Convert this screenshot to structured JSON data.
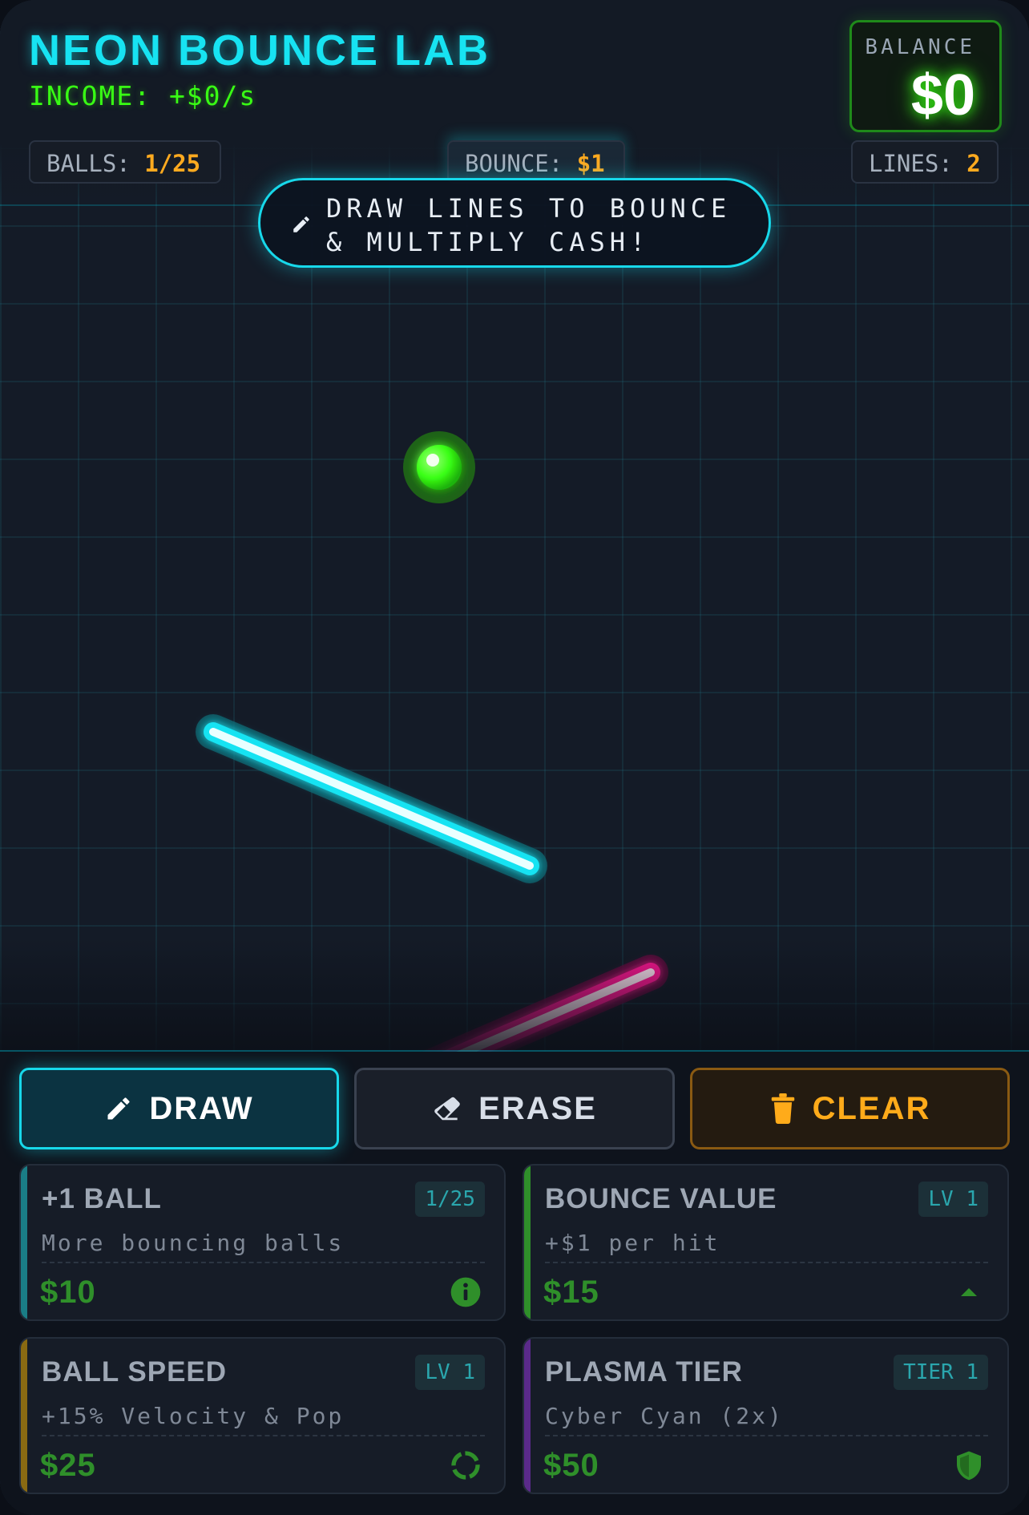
{
  "header": {
    "title": "NEON BOUNCE LAB",
    "income": "INCOME: +$0/s",
    "balance_label": "BALANCE",
    "balance_value": "$0"
  },
  "stats": {
    "balls_label": "BALLS:",
    "balls_value": "1/25",
    "bounce_label": "BOUNCE:",
    "bounce_value": "$1",
    "lines_label": "LINES:",
    "lines_value": "2"
  },
  "hint": {
    "text": "DRAW LINES TO BOUNCE & MULTIPLY CASH!",
    "icon": "pencil-icon"
  },
  "scene": {
    "lines": [
      {
        "color": "#17e3f2",
        "name": "cyan-line"
      },
      {
        "color": "#ff1493",
        "name": "magenta-line"
      }
    ],
    "ball_color": "#39ff14"
  },
  "tools": {
    "draw_label": "DRAW",
    "erase_label": "ERASE",
    "clear_label": "CLEAR"
  },
  "upgrades": [
    {
      "title": "+1 BALL",
      "badge": "1/25",
      "desc": "More bouncing balls",
      "price": "$10",
      "icon": "info-icon",
      "accent": "#1a7d86"
    },
    {
      "title": "BOUNCE VALUE",
      "badge": "LV 1",
      "desc": "+$1 per hit",
      "price": "$15",
      "icon": "chevron-up-icon",
      "accent": "#2f8f2a"
    },
    {
      "title": "BALL SPEED",
      "badge": "LV 1",
      "desc": "+15% Velocity & Pop",
      "price": "$25",
      "icon": "loading-ring-icon",
      "accent": "#8a6a12"
    },
    {
      "title": "PLASMA TIER",
      "badge": "TIER 1",
      "desc": "Cyber Cyan (2x)",
      "price": "$50",
      "icon": "shield-icon",
      "accent": "#5a2a8a"
    }
  ],
  "colors": {
    "accent_cyan": "#17e3f2",
    "accent_green": "#39ff14",
    "accent_orange": "#ffab1a",
    "accent_magenta": "#ff1493"
  }
}
